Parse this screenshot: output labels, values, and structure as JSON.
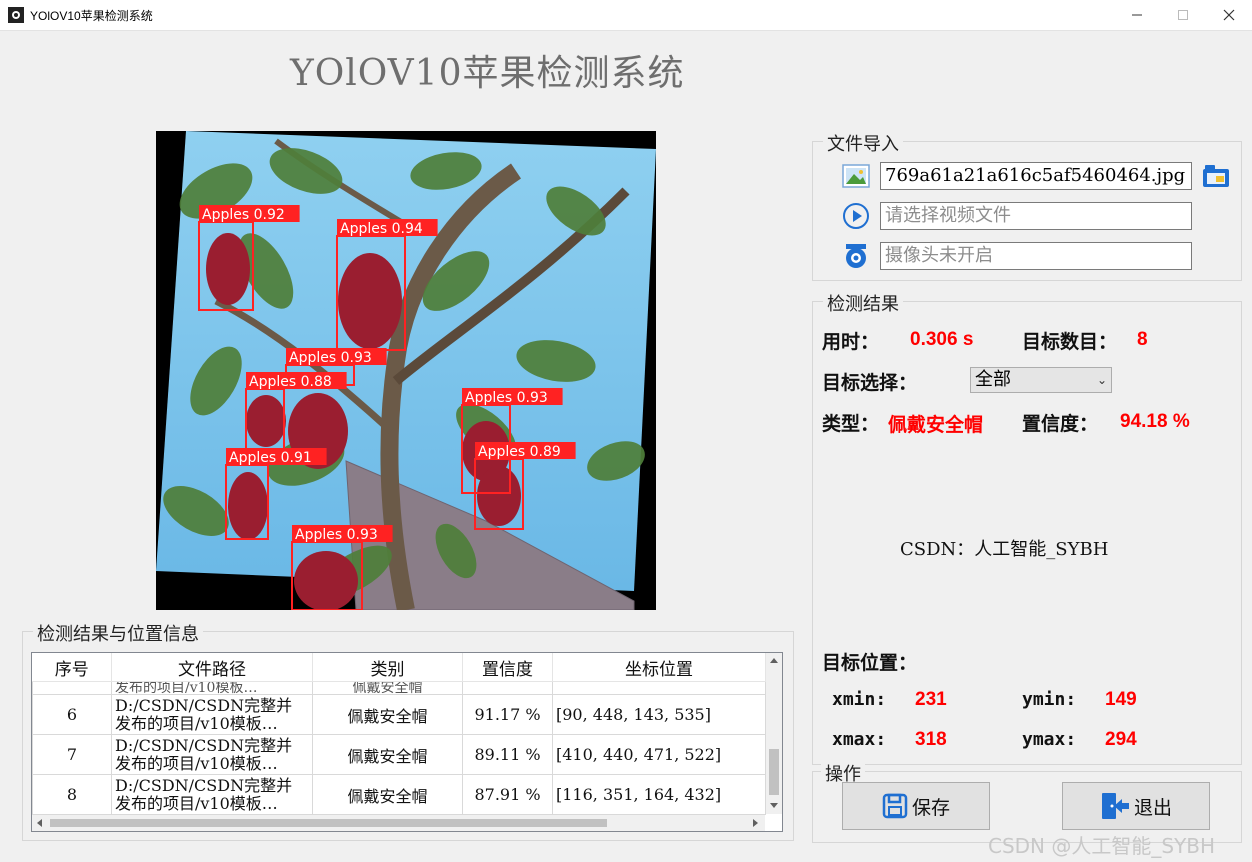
{
  "window": {
    "title": "YOlOV10苹果检测系统"
  },
  "page_title": "YOlOV10苹果检测系统",
  "detections_overlay": [
    {
      "label": "Apples 0.92"
    },
    {
      "label": "Apples 0.94"
    },
    {
      "label": "Apples 0.93"
    },
    {
      "label": "Apples 0.88"
    },
    {
      "label": "Apples 0.93"
    },
    {
      "label": "Apples 0.91"
    },
    {
      "label": "Apples 0.89"
    },
    {
      "label": "Apples 0.93"
    }
  ],
  "file_import": {
    "title": "文件导入",
    "image_value": "769a61a21a616c5af5460464.jpg",
    "video_placeholder": "请选择视频文件",
    "camera_placeholder": "摄像头未开启"
  },
  "results": {
    "title": "检测结果",
    "time_label": "用时：",
    "time_value": "0.306 s",
    "count_label": "目标数目：",
    "count_value": "8",
    "select_label": "目标选择：",
    "select_value": "全部",
    "type_label": "类型：",
    "type_value": "佩戴安全帽",
    "conf_label": "置信度：",
    "conf_value": "94.18 %",
    "center_text": "CSDN：人工智能_SYBH",
    "position_label": "目标位置：",
    "xmin_label": "xmin:",
    "xmin_value": "231",
    "ymin_label": "ymin:",
    "ymin_value": "149",
    "xmax_label": "xmax:",
    "xmax_value": "318",
    "ymax_label": "ymax:",
    "ymax_value": "294"
  },
  "operations": {
    "title": "操作",
    "save_label": "保存",
    "exit_label": "退出"
  },
  "table": {
    "title": "检测结果与位置信息",
    "headers": [
      "序号",
      "文件路径",
      "类别",
      "置信度",
      "坐标位置"
    ],
    "partial_row": {
      "path": "发布的项目/v10模板…",
      "class": "佩戴安全帽"
    },
    "rows": [
      {
        "index": "6",
        "path1": "D:/CSDN/CSDN完整并",
        "path2": "发布的项目/v10模板…",
        "class": "佩戴安全帽",
        "conf": "91.17 %",
        "coords": "[90, 448, 143, 535]"
      },
      {
        "index": "7",
        "path1": "D:/CSDN/CSDN完整并",
        "path2": "发布的项目/v10模板…",
        "class": "佩戴安全帽",
        "conf": "89.11 %",
        "coords": "[410, 440, 471, 522]"
      },
      {
        "index": "8",
        "path1": "D:/CSDN/CSDN完整并",
        "path2": "发布的项目/v10模板…",
        "class": "佩戴安全帽",
        "conf": "87.91 %",
        "coords": "[116, 351, 164, 432]"
      }
    ]
  },
  "watermark": "CSDN @人工智能_SYBH",
  "colors": {
    "accent": "#ff0000",
    "bbox": "#ff2222",
    "icon_blue": "#1f6fd1"
  }
}
